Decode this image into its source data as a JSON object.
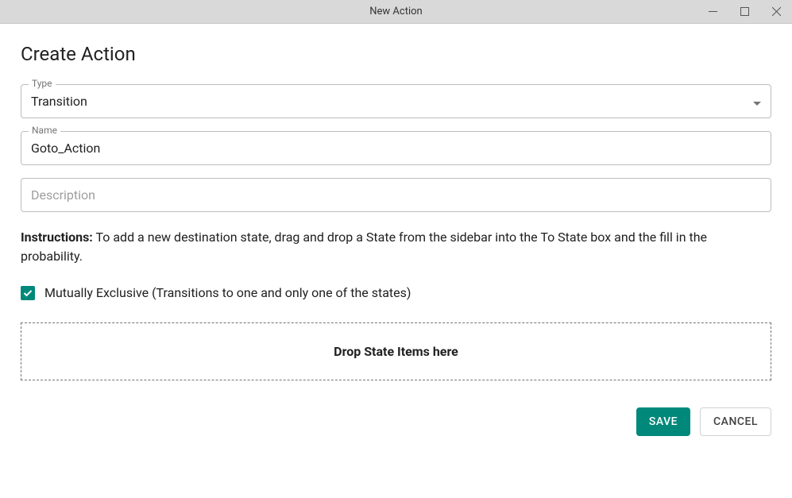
{
  "window": {
    "title": "New Action"
  },
  "page": {
    "heading": "Create Action"
  },
  "fields": {
    "type": {
      "label": "Type",
      "value": "Transition"
    },
    "name": {
      "label": "Name",
      "value": "Goto_Action"
    },
    "description": {
      "placeholder": "Description",
      "value": ""
    }
  },
  "instructions": {
    "label": "Instructions:",
    "text": " To add a new destination state, drag and drop a State from the sidebar into the To State box and the fill in the probability."
  },
  "checkbox": {
    "label": "Mutually Exclusive (Transitions to one and only one of the states)",
    "checked": true
  },
  "dropzone": {
    "text": "Drop State Items here"
  },
  "buttons": {
    "save": "SAVE",
    "cancel": "CANCEL"
  }
}
